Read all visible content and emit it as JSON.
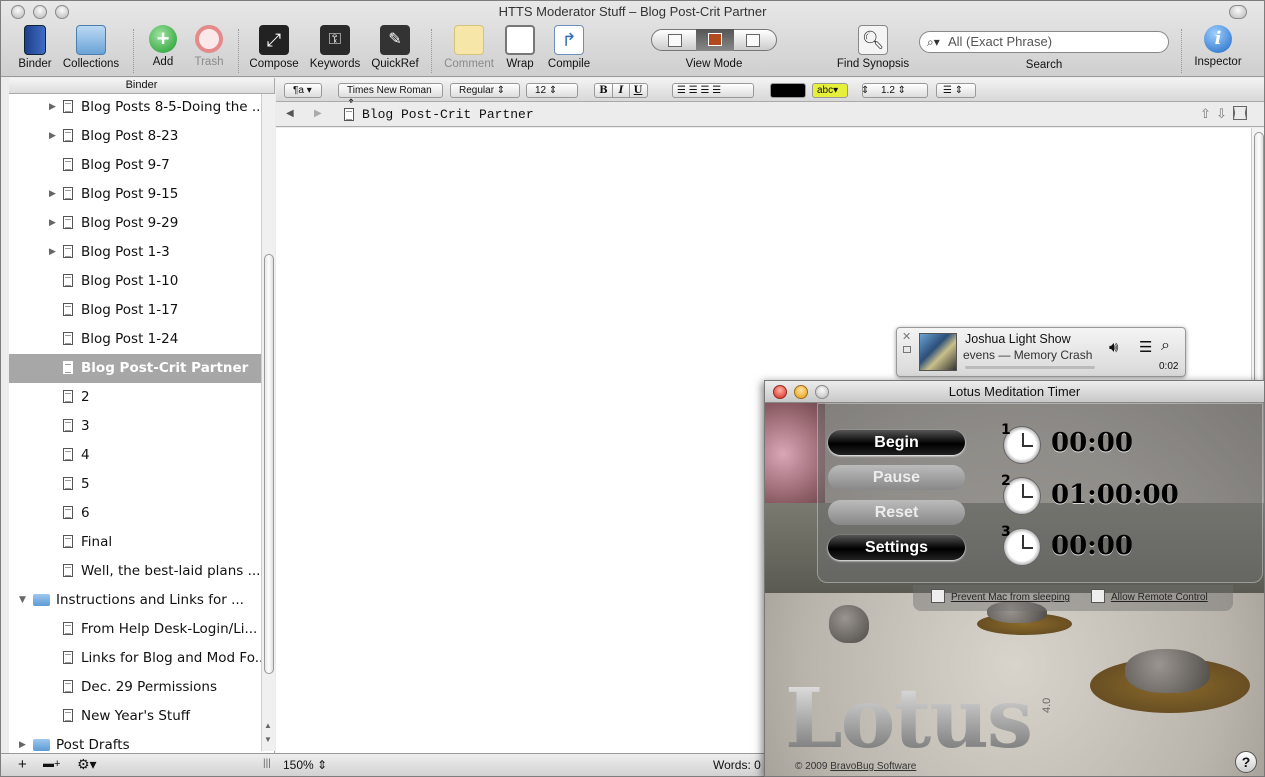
{
  "window": {
    "title": "HTTS Moderator Stuff – Blog Post-Crit Partner"
  },
  "toolbar": {
    "binder": "Binder",
    "collections": "Collections",
    "add": "Add",
    "trash": "Trash",
    "compose": "Compose",
    "keywords": "Keywords",
    "quickref": "QuickRef",
    "comment": "Comment",
    "wrap": "Wrap",
    "compile": "Compile",
    "view_mode": "View Mode",
    "find_synopsis": "Find Synopsis",
    "search_placeholder": "All (Exact Phrase)",
    "search_label": "Search",
    "inspector": "Inspector"
  },
  "binder": {
    "header": "Binder",
    "items": [
      {
        "label": "Blog Posts 8-5-Doing the ..."
      },
      {
        "label": "Blog Post 8-23"
      },
      {
        "label": "Blog Post 9-7"
      },
      {
        "label": "Blog Post 9-15"
      },
      {
        "label": "Blog Post 9-29"
      },
      {
        "label": "Blog Post 1-3"
      },
      {
        "label": "Blog Post 1-10"
      },
      {
        "label": "Blog Post 1-17"
      },
      {
        "label": "Blog Post 1-24"
      },
      {
        "label": "Blog Post-Crit Partner"
      },
      {
        "label": "2"
      },
      {
        "label": "3"
      },
      {
        "label": "4"
      },
      {
        "label": "5"
      },
      {
        "label": "6"
      },
      {
        "label": "Final"
      },
      {
        "label": "Well, the best-laid plans ..."
      },
      {
        "label": "Instructions and Links for ..."
      },
      {
        "label": "From Help Desk-Login/Li..."
      },
      {
        "label": "Links for Blog and Mod Fo..."
      },
      {
        "label": "Dec. 29 Permissions"
      },
      {
        "label": "New Year's Stuff"
      },
      {
        "label": "Post Drafts"
      }
    ]
  },
  "format_bar": {
    "para": "¶a",
    "font": "Times New Roman",
    "style": "Regular",
    "size": "12",
    "bold": "B",
    "italic": "I",
    "underline": "U",
    "highlight": "abc",
    "spacing": "1.2"
  },
  "editor": {
    "doc_title": "Blog Post-Crit Partner",
    "zoom": "150%",
    "words": "Words: 0"
  },
  "itunes": {
    "track": "Joshua Light Show",
    "artist_album": "evens — Memory Crash",
    "time": "0:02"
  },
  "lotus": {
    "title": "Lotus Meditation Timer",
    "buttons": {
      "begin": "Begin",
      "pause": "Pause",
      "reset": "Reset",
      "settings": "Settings"
    },
    "timers": [
      {
        "num": "1",
        "time": "00:00"
      },
      {
        "num": "2",
        "time": "01:00:00"
      },
      {
        "num": "3",
        "time": "00:00"
      }
    ],
    "prevent_sleep": "Prevent Mac from sleeping",
    "allow_remote": "Allow Remote Control",
    "logo": "Lotus",
    "version": "4.0",
    "copyright_prefix": "© 2009",
    "company": "BravoBug Software",
    "help": "?"
  }
}
